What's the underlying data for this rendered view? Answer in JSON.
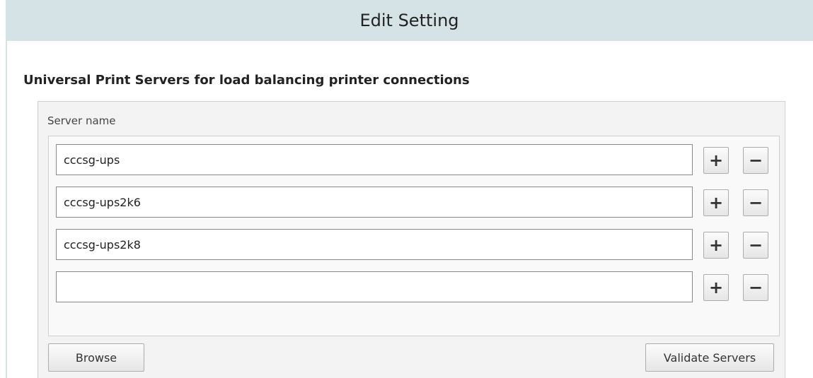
{
  "window": {
    "title": "Edit Setting"
  },
  "setting": {
    "heading": "Universal Print Servers for load balancing printer connections",
    "column_label": "Server name",
    "servers": [
      {
        "value": "cccsg-ups",
        "add_label": "+",
        "remove_label": "−"
      },
      {
        "value": "cccsg-ups2k6",
        "add_label": "+",
        "remove_label": "−"
      },
      {
        "value": "cccsg-ups2k8",
        "add_label": "+",
        "remove_label": "−"
      },
      {
        "value": "",
        "add_label": "+",
        "remove_label": "−"
      }
    ],
    "browse_label": "Browse",
    "validate_label": "Validate Servers"
  },
  "colors": {
    "title_bar": "#d6e3e6",
    "panel_bg": "#f3f3f3",
    "button_border": "#acacac"
  },
  "icons": {
    "add": "plus-icon",
    "remove": "minus-icon"
  }
}
